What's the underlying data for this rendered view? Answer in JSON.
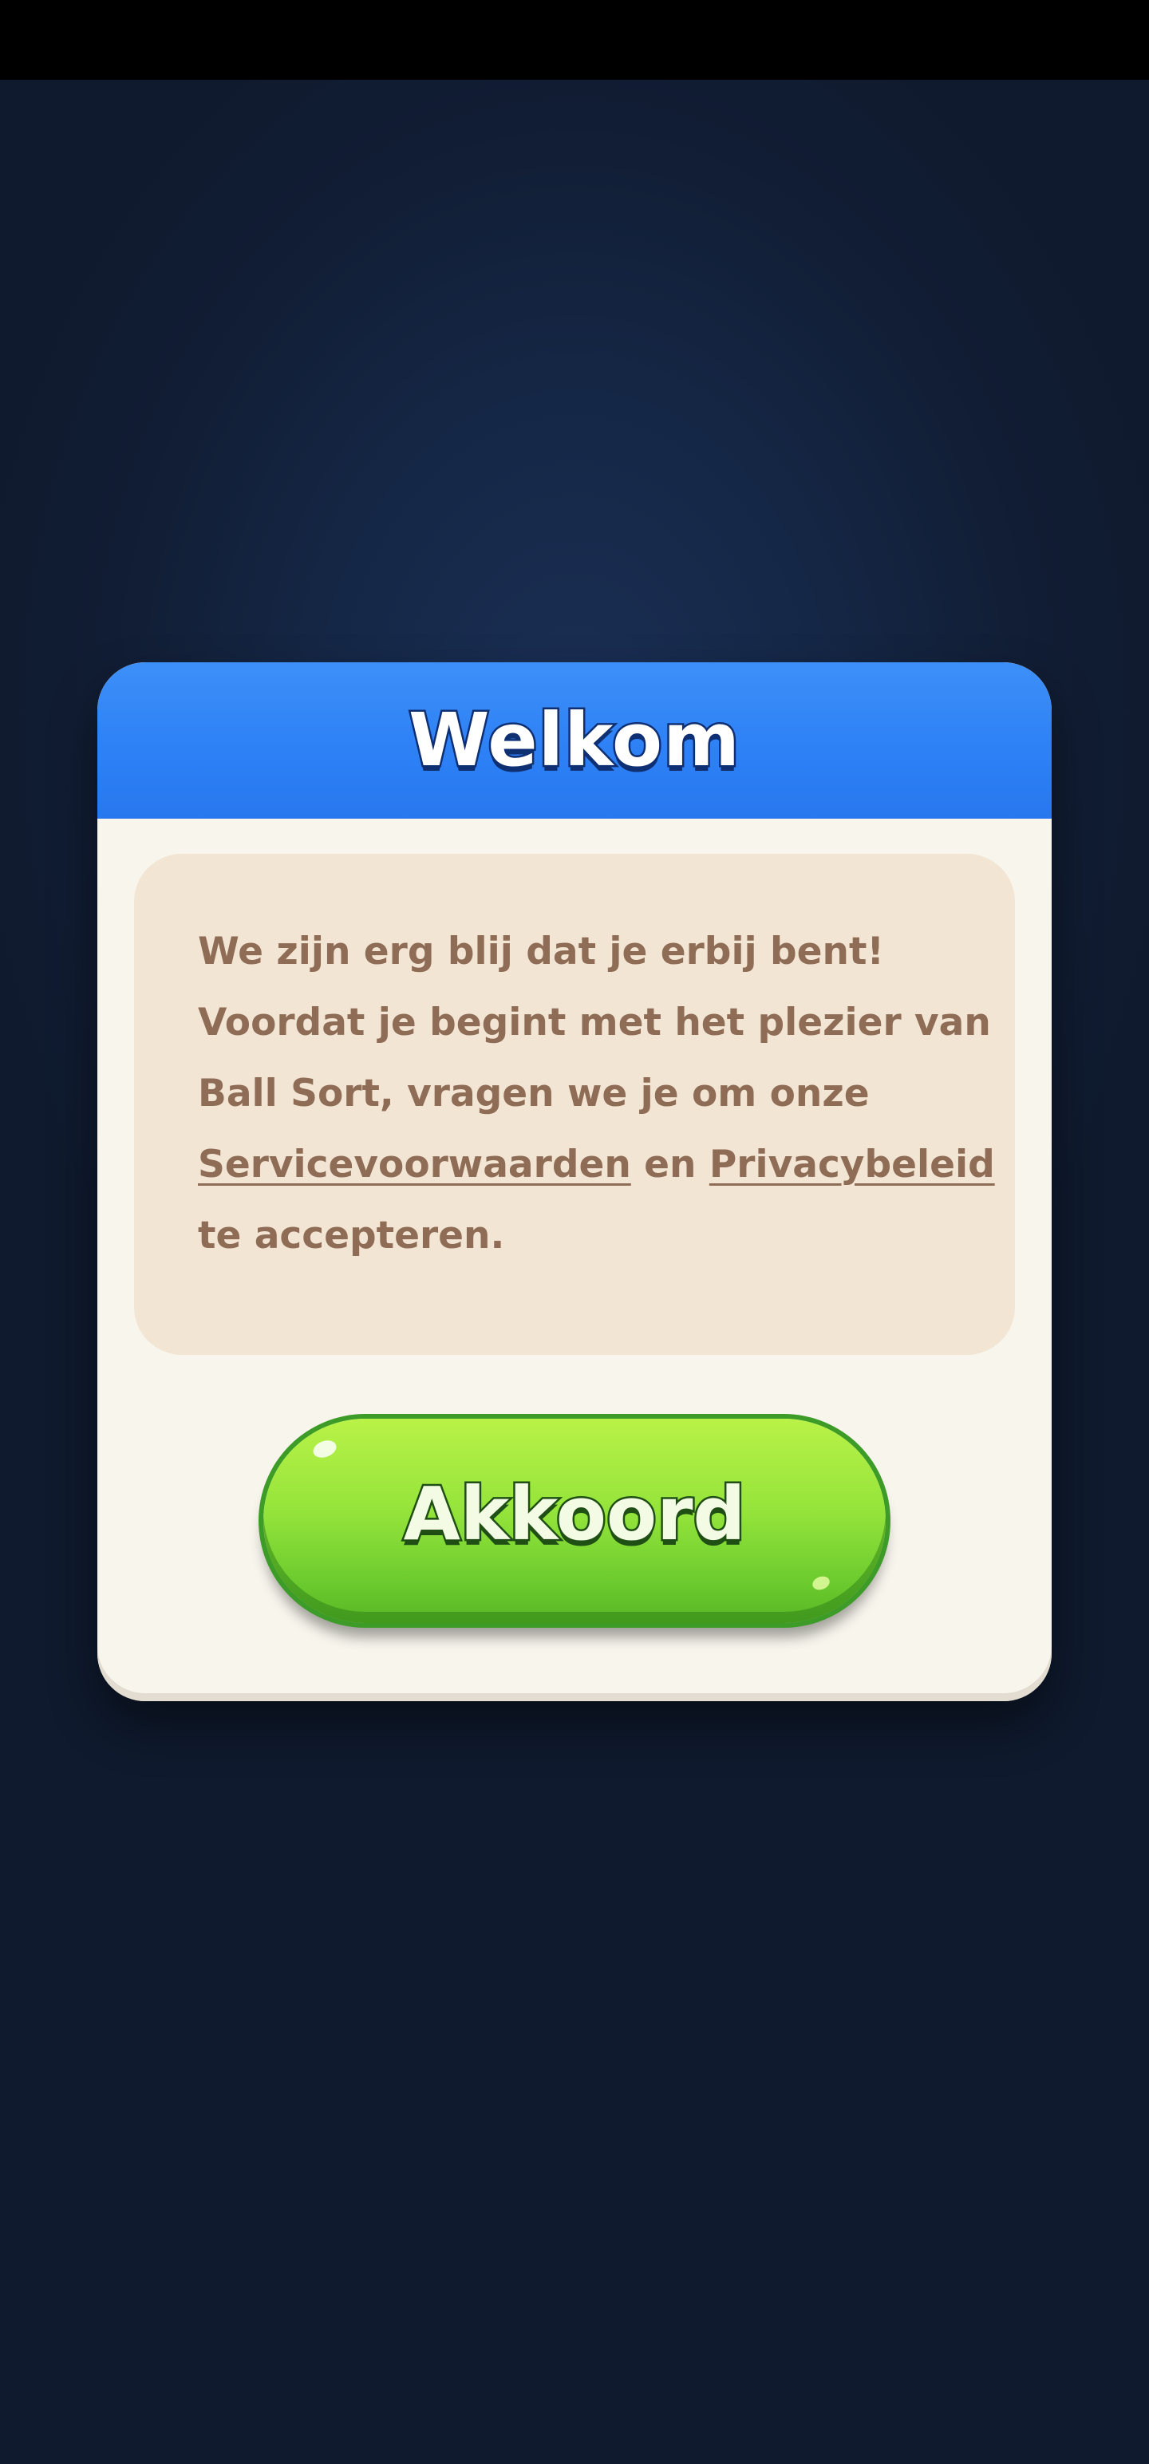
{
  "dialog": {
    "title": "Welkom",
    "message": {
      "line1": "We zijn erg blij dat je erbij bent!",
      "line2": "Voordat je begint met het plezier van",
      "line3": "Ball Sort, vragen we je om onze",
      "terms_link": "Servicevoorwaarden",
      "conjunction": " en ",
      "privacy_link": "Privacybeleid",
      "line5": "te accepteren."
    },
    "accept_label": "Akkoord"
  },
  "colors": {
    "header_blue": "#2d80f5",
    "panel_cream": "#f7f5ec",
    "message_bg": "#f2e5d3",
    "message_text": "#8e6c55",
    "button_green": "#95e43b"
  }
}
